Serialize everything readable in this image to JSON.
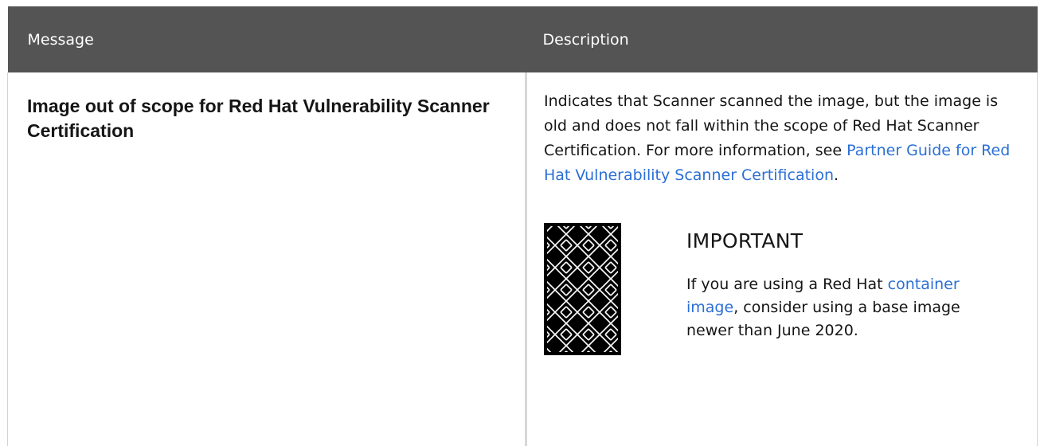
{
  "table": {
    "headers": {
      "message": "Message",
      "description": "Description"
    },
    "rows": [
      {
        "message": "Image out of scope for Red Hat Vulnerability Scanner Certification",
        "description": {
          "text_before": "Indicates that Scanner scanned the image, but the image is old and does not fall within the scope of Red Hat Scanner Certification. For more information, see ",
          "link_text": "Partner Guide for Red Hat Vulnerability Scanner Certification",
          "text_after": "."
        },
        "admonition": {
          "icon": "important-icon",
          "title": "IMPORTANT",
          "text_before": "If you are using a Red Hat ",
          "link_text": "container image",
          "text_after": ", consider using a base image newer than June 2020."
        }
      }
    ]
  },
  "colors": {
    "header_background": "#545454",
    "link": "#2b6fd6",
    "text": "#151515"
  }
}
